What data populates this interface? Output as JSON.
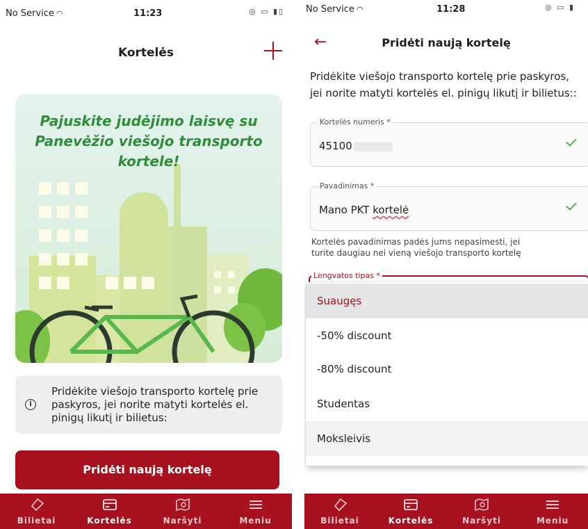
{
  "left": {
    "status": {
      "carrier": "No Service",
      "time": "11:23"
    },
    "title": "Kortelės",
    "hero_text": "Pajuskite judėjimo laisvę su Panevėžio viešojo transporto kortele!",
    "info_text": "Pridėkite viešojo transporto kortelę prie paskyros, jei norite matyti kortelės el. pinigų likutį ir bilietus:",
    "add_button": "Pridėti naują kortelę"
  },
  "right": {
    "status": {
      "carrier": "No Service",
      "time": "11:28"
    },
    "title": "Pridėti naują kortelę",
    "intro_line1": "Pridėkite viešojo transporto kortelę prie paskyros,",
    "intro_line2": "jei norite matyti kortelės el. pinigų likutį ir bilietus::",
    "card_number": {
      "label": "Kortelės numeris *",
      "value": "45100"
    },
    "name_field": {
      "label": "Pavadinimas *",
      "value_prefix": "Mano PKT ",
      "value_word": "kortelė"
    },
    "helper_line1": "Kortelės pavadinimas padės jums nepasimesti, jei",
    "helper_line2": "turite daugiau nei vieną viešojo transporto kortelę",
    "discount_label": "Lengvatos tipas *",
    "options": [
      "Suaugęs",
      "-50% discount",
      "-80% discount",
      "Studentas",
      "Moksleivis"
    ],
    "selected_option": "Suaugęs"
  },
  "tabs": [
    {
      "label": "Bilietai",
      "icon": "ticket-icon"
    },
    {
      "label": "Kortelės",
      "icon": "card-icon"
    },
    {
      "label": "Naršyti",
      "icon": "map-search-icon"
    },
    {
      "label": "Meniu",
      "icon": "menu-icon"
    }
  ],
  "colors": {
    "brand": "#a8111f",
    "hero_green": "#2f8c3a",
    "check_green": "#49b84a"
  }
}
